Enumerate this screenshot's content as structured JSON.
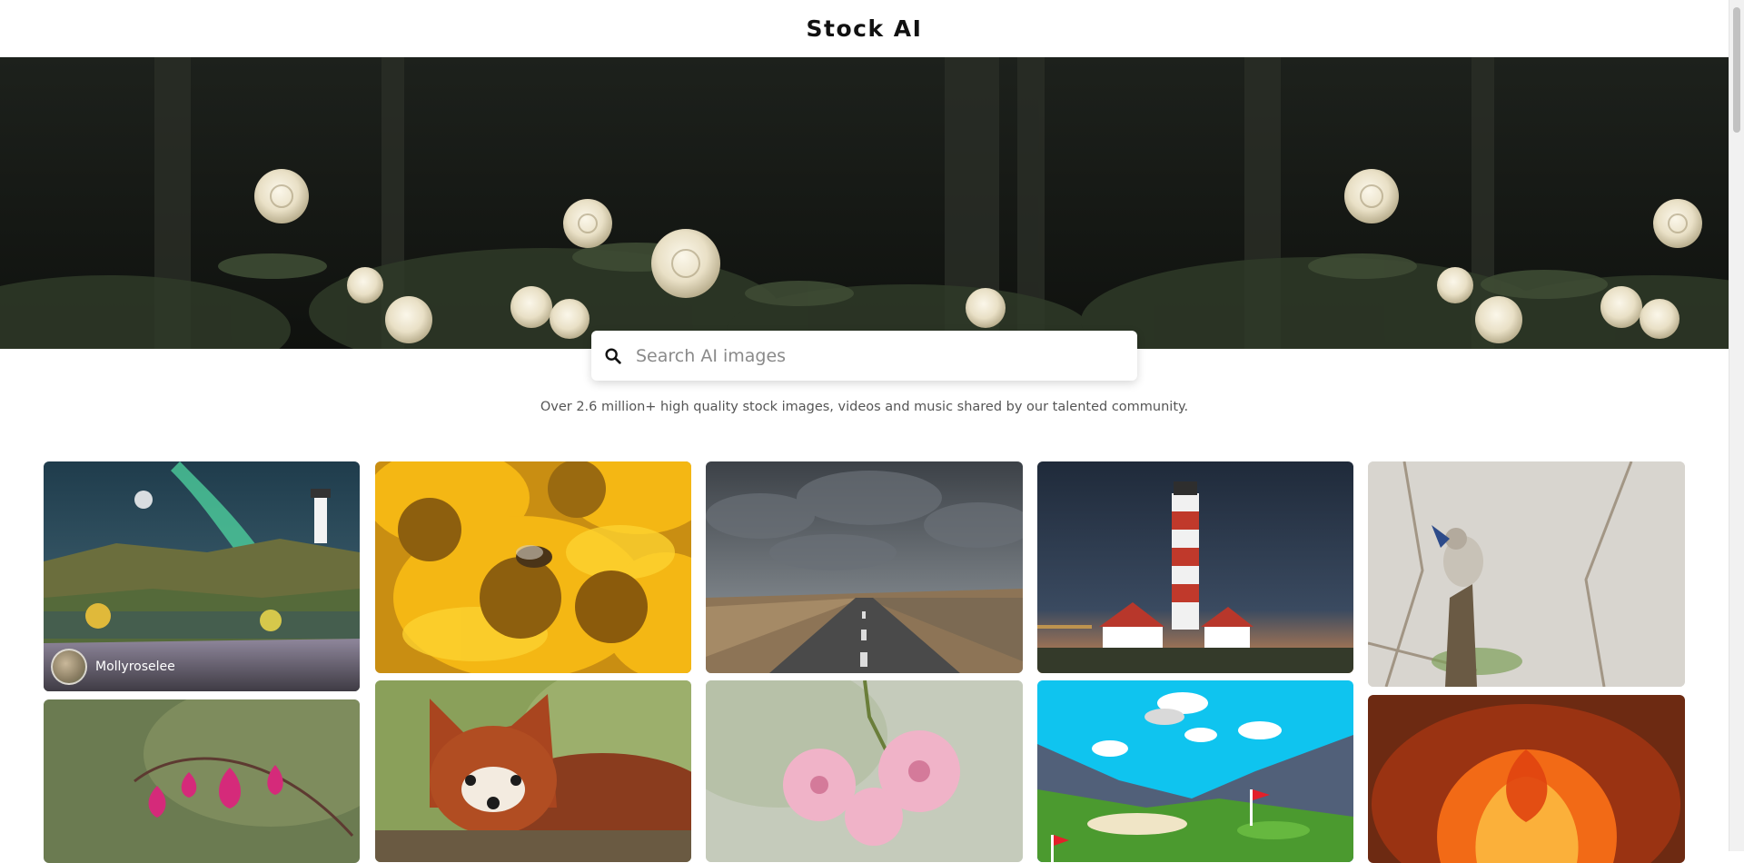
{
  "header": {
    "title": "Stock AI"
  },
  "search": {
    "placeholder": "Search AI images",
    "icon": "search-icon"
  },
  "tagline": "Over 2.6 million+ high quality stock images, videos and music shared by our talented community.",
  "gallery": {
    "cards": [
      {
        "subject": "lighthouse-aurora",
        "author": "Mollyroselee"
      },
      {
        "subject": "yellow-flowers-bee"
      },
      {
        "subject": "stormy-road"
      },
      {
        "subject": "red-white-lighthouse-night"
      },
      {
        "subject": "small-bird-on-branch"
      },
      {
        "subject": "bleeding-heart-flowers"
      },
      {
        "subject": "red-panda"
      },
      {
        "subject": "pink-blossoms"
      },
      {
        "subject": "cartoon-golf-course"
      },
      {
        "subject": "orange-tulip"
      }
    ]
  },
  "colors": {
    "brand_text": "#111111",
    "tagline_text": "#555555"
  }
}
